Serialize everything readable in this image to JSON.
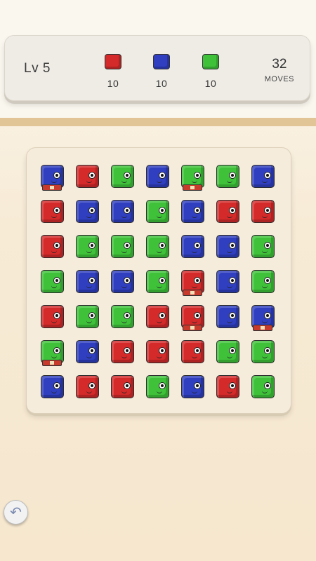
{
  "hud": {
    "level_label": "Lv 5",
    "goals": [
      {
        "color": "red",
        "count": "10"
      },
      {
        "color": "blue",
        "count": "10"
      },
      {
        "color": "green",
        "count": "10"
      }
    ],
    "moves_value": "32",
    "moves_label": "MOVES"
  },
  "colors": {
    "red": "#d42a2a",
    "blue": "#2f3fbf",
    "green": "#3fc23a"
  },
  "board": {
    "cells": [
      [
        "blue",
        "red",
        "green",
        "blue",
        "green",
        "green",
        "blue"
      ],
      [
        "red",
        "blue",
        "blue",
        "green",
        "blue",
        "red",
        "red"
      ],
      [
        "red",
        "green",
        "green",
        "green",
        "blue",
        "blue",
        "green"
      ],
      [
        "green",
        "blue",
        "blue",
        "green",
        "red",
        "blue",
        "green"
      ],
      [
        "red",
        "green",
        "green",
        "red",
        "red",
        "blue",
        "blue"
      ],
      [
        "green",
        "blue",
        "red",
        "red",
        "red",
        "green",
        "green"
      ],
      [
        "blue",
        "red",
        "red",
        "green",
        "blue",
        "red",
        "green"
      ]
    ],
    "bombs": [
      [
        0,
        0
      ],
      [
        0,
        4
      ],
      [
        3,
        4
      ],
      [
        4,
        4
      ],
      [
        4,
        6
      ],
      [
        5,
        0
      ]
    ]
  },
  "controls": {
    "undo_icon": "undo-icon"
  }
}
